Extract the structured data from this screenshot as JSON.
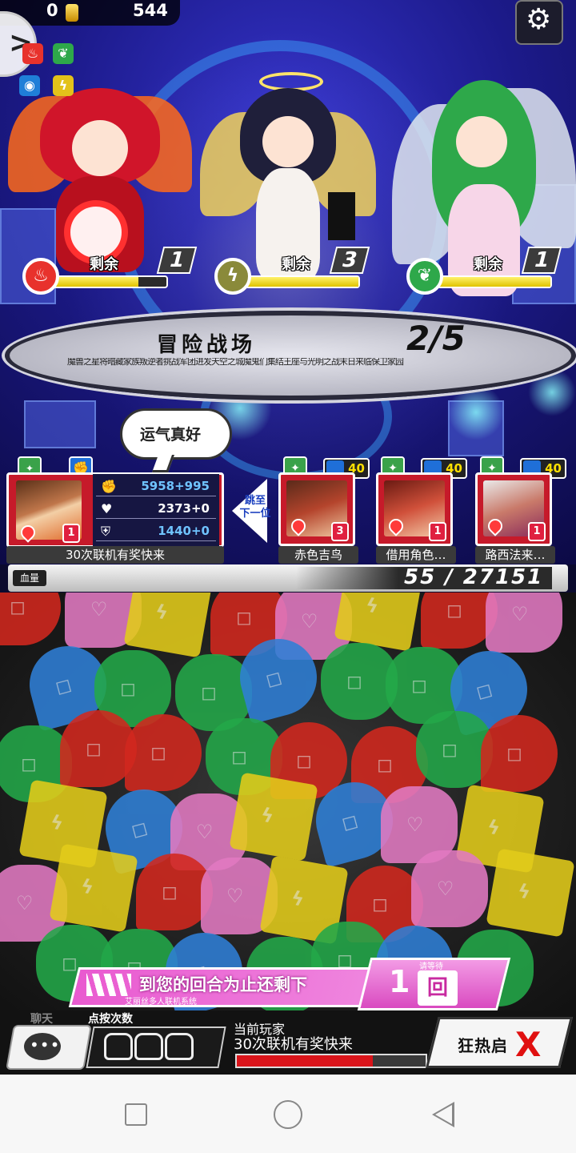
{
  "topbar": {
    "stamina": "0",
    "coins": "544",
    "mini_attrs": [
      {
        "icon": "fire-icon",
        "color": "#e8322c",
        "glyph": "♨"
      },
      {
        "icon": "leaf-icon",
        "color": "#2ea84a",
        "glyph": "❦"
      },
      {
        "icon": "water-icon",
        "color": "#1f7fd8",
        "glyph": "◉"
      },
      {
        "icon": "lightning-icon",
        "color": "#e3c21a",
        "glyph": "ϟ"
      }
    ]
  },
  "bosses": [
    {
      "remaining_label": "剩余",
      "remaining": "1",
      "element": "fire",
      "color": "#e8322c",
      "glyph": "♨",
      "hp_fraction": 0.75
    },
    {
      "remaining_label": "剩余",
      "remaining": "3",
      "element": "lightning",
      "color": "#8a8a3a",
      "glyph": "ϟ",
      "hp_fraction": 1.0
    },
    {
      "remaining_label": "剩余",
      "remaining": "1",
      "element": "wood",
      "color": "#2ea84a",
      "glyph": "❦",
      "hp_fraction": 1.0
    }
  ],
  "stage": {
    "title": "冒险战场",
    "progress": "2/5",
    "subtitle": "魔兽之星将暗藏家族叛逆者挑战军团进发天空之城魔鬼们集结王座与光明之战末日来临保卫家园"
  },
  "bubble_text": "运气真好",
  "me": {
    "name": "30次联机有奖快来",
    "level": "1",
    "stats": [
      {
        "icon": "fist-icon",
        "glyph": "✊",
        "value": "5958+995",
        "color": "#6fc3ff"
      },
      {
        "icon": "heart-icon",
        "glyph": "♥",
        "value": "2373+0",
        "color": "#ffffff"
      },
      {
        "icon": "shield-icon",
        "glyph": "⛨",
        "value": "1440+0",
        "color": "#6fc3ff"
      }
    ]
  },
  "skip_label": "跳至\n下一位",
  "teammates": [
    {
      "name": "赤色吉鸟",
      "level": "3",
      "badge": "40",
      "portrait_color": "#b4442c"
    },
    {
      "name": "借用角色…",
      "level": "1",
      "badge": "40",
      "portrait_color": "#d0503a"
    },
    {
      "name": "路西法来…",
      "level": "1",
      "badge": "40",
      "portrait_color": "#c97a6a"
    }
  ],
  "hp": {
    "label": "血量",
    "value": "55 / 27151"
  },
  "turn_banner": {
    "text": "到您的回合为止还剩下",
    "sub": "艾丽丝多人联机系统",
    "wait_label": "请等待",
    "count": "1",
    "unit": "回"
  },
  "controls": {
    "chat_label": "聊天",
    "chat_glyph": "•••",
    "tap_label": "点按次数",
    "current_label": "当前玩家",
    "current_player": "30次联机有奖快来",
    "current_progress": 0.72,
    "frenzy_label": "狂热启动",
    "frenzy_label_shown": "狂热启",
    "frenzy_x": "X"
  }
}
